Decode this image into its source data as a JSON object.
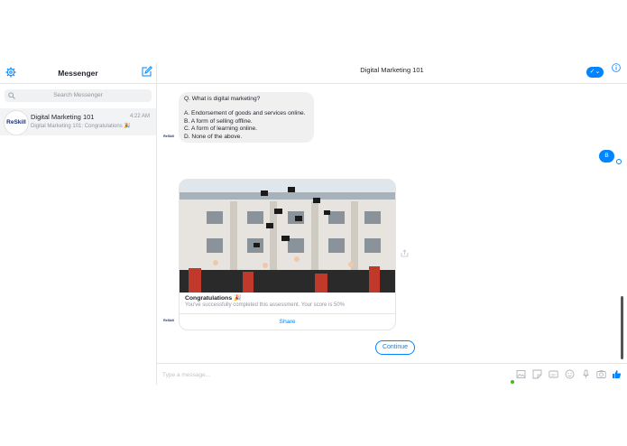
{
  "sidebar": {
    "title": "Messenger",
    "search_placeholder": "Search Messenger",
    "conversation": {
      "avatar_text": "ReSkill",
      "name": "Digital Marketing 101",
      "time": "4:22 AM",
      "preview": "Digital Marketing 101: Congratulations 🎉"
    }
  },
  "header": {
    "title": "Digital Marketing 101",
    "check_icon": "checkmark-chevron-icon",
    "info_icon": "info-icon"
  },
  "chat": {
    "bot_avatar_text": "ReSkill",
    "question": "Q. What is digital marketing?",
    "options": [
      "A. Endorsement of goods and services online.",
      "B. A form of selling offline.",
      "C. A form of learning online.",
      "D. None of the above."
    ],
    "user_reply": "B",
    "card": {
      "title": "Congratulations 🎉",
      "subtitle": "You've successfully completed this assessment. Your score is 50%",
      "share_label": "Share"
    },
    "continue_label": "Continue"
  },
  "composer": {
    "placeholder": "Type a message...",
    "icons": [
      "image-icon",
      "sticker-icon",
      "gif-icon",
      "emoji-icon",
      "microphone-icon",
      "camera-icon",
      "thumbs-up-icon"
    ]
  },
  "colors": {
    "accent": "#0084ff",
    "bubble_gray": "#f1f0f0",
    "online": "#42b72a"
  }
}
